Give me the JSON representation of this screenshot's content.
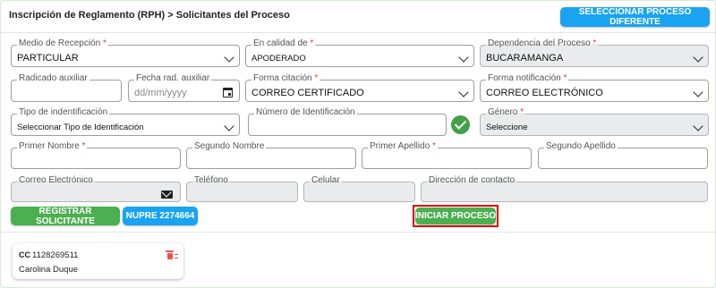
{
  "header": {
    "title": "Inscripción de Reglamento (RPH) > Solicitantes del Proceso",
    "select_process_label": "SELECCIONAR PROCESO DIFERENTE"
  },
  "form": {
    "medio_recepcion": {
      "label": "Medio de Recepción",
      "required": "*",
      "value": "PARTICULAR"
    },
    "en_calidad_de": {
      "label": "En calidad de",
      "required": "*",
      "value": "APODERADO"
    },
    "dependencia": {
      "label": "Dependencia del Proceso",
      "required": "*",
      "value": "BUCARAMANGA"
    },
    "radicado_auxiliar": {
      "label": "Radicado auxiliar",
      "value": ""
    },
    "fecha_rad_auxiliar": {
      "label": "Fecha rad. auxiliar",
      "placeholder": "dd/mm/yyyy"
    },
    "forma_citacion": {
      "label": "Forma citación",
      "required": "*",
      "value": "CORREO CERTIFICADO"
    },
    "forma_notificacion": {
      "label": "Forma notificación",
      "required": "*",
      "value": "CORREO ELECTRÓNICO"
    },
    "tipo_identificacion": {
      "label": "Tipo de indentificación",
      "value": "Seleccionar Tipo de Identificación"
    },
    "numero_identificacion": {
      "label": "Número de Identificación",
      "value": ""
    },
    "genero": {
      "label": "Género",
      "required": "*",
      "value": "Seleccione"
    },
    "primer_nombre": {
      "label": "Primer Nombre",
      "required": "*",
      "value": ""
    },
    "segundo_nombre": {
      "label": "Segundo Nombre",
      "value": ""
    },
    "primer_apellido": {
      "label": "Primer Apellido",
      "required": "*",
      "value": ""
    },
    "segundo_apellido": {
      "label": "Segundo Apellido",
      "value": ""
    },
    "correo": {
      "label": "Correo Electrónico",
      "value": ""
    },
    "telefono": {
      "label": "Teléfono",
      "value": ""
    },
    "celular": {
      "label": "Celular",
      "value": ""
    },
    "direccion": {
      "label": "Dirección de contacto",
      "value": ""
    }
  },
  "actions": {
    "registrar_label": "REGISTRAR SOLICITANTE",
    "nupre_label": "NUPRE 2274664",
    "iniciar_label": "INICIAR PROCESO"
  },
  "solicitantes": [
    {
      "doc_type": "CC",
      "doc_number": "1128269511",
      "name": "Carolina Duque"
    }
  ],
  "colors": {
    "blue_button": "#1aa3f0",
    "green_button": "#4caf50",
    "highlight_border": "#e00000",
    "required_asterisk": "#e53935",
    "check_ok": "#43a047",
    "delete_icon": "#ef5350"
  },
  "icons": {
    "calendar": "calendar-icon",
    "check": "check-circle-icon",
    "email": "mail-icon",
    "delete": "trash-icon",
    "dropdown": "chevron-down-icon"
  }
}
